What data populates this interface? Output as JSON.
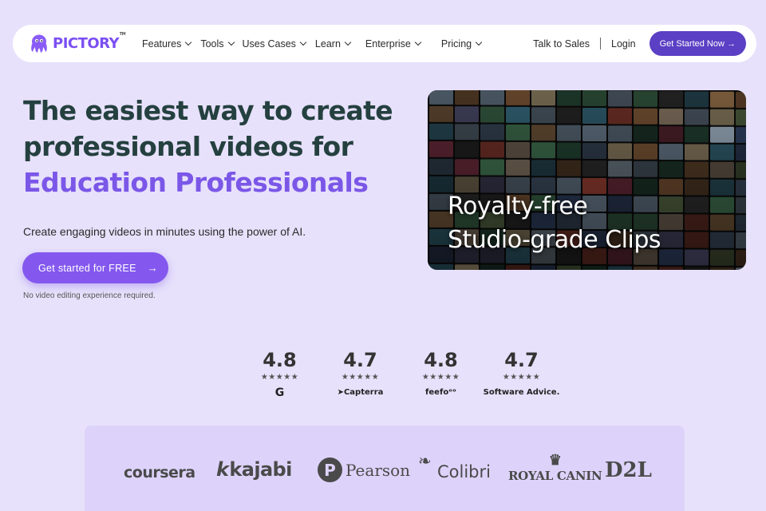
{
  "nav": {
    "logo_text": "PICTORY",
    "logo_tm": "TM",
    "menu": [
      {
        "label": "Features"
      },
      {
        "label": "Tools"
      },
      {
        "label": "Uses Cases"
      },
      {
        "label": "Learn"
      },
      {
        "label": "Enterprise"
      },
      {
        "label": "Pricing"
      }
    ],
    "talk_to_sales": "Talk to Sales",
    "login": "Login",
    "get_started_now": "Get Started Now →"
  },
  "hero": {
    "title_line1": "The easiest way to create",
    "title_line2": "professional videos for",
    "title_highlight": "Education Professionals",
    "subtitle": "Create engaging videos in minutes using the power of AI.",
    "cta_label": "Get started for FREE",
    "cta_arrow": "→",
    "note": "No video editing experience required.",
    "image_caption_line1": "Royalty-free",
    "image_caption_line2": "Studio-grade Clips"
  },
  "ratings": [
    {
      "score": "4.8",
      "stars": "★★★★★",
      "platform": "G"
    },
    {
      "score": "4.7",
      "stars": "★★★★★",
      "platform": "➤Capterra"
    },
    {
      "score": "4.8",
      "stars": "★★★★★",
      "platform": "feefoᵒᵒ"
    },
    {
      "score": "4.7",
      "stars": "★★★★★",
      "platform": "Software Advice."
    }
  ],
  "logos": {
    "coursera": "coursera",
    "kajabi_k": "k",
    "kajabi": "kajabi",
    "pearson_p": "P",
    "pearson": "Pearson",
    "colibri_leaf": "❧",
    "colibri": "Colibri",
    "royal_crown": "♛",
    "royal_canin": "ROYAL CANIN",
    "d2l": "D2L"
  },
  "colors": {
    "background": "#e7e1fb",
    "accent": "#7b57e8",
    "nav_cta": "#5b3fc4",
    "title": "#24403f"
  }
}
